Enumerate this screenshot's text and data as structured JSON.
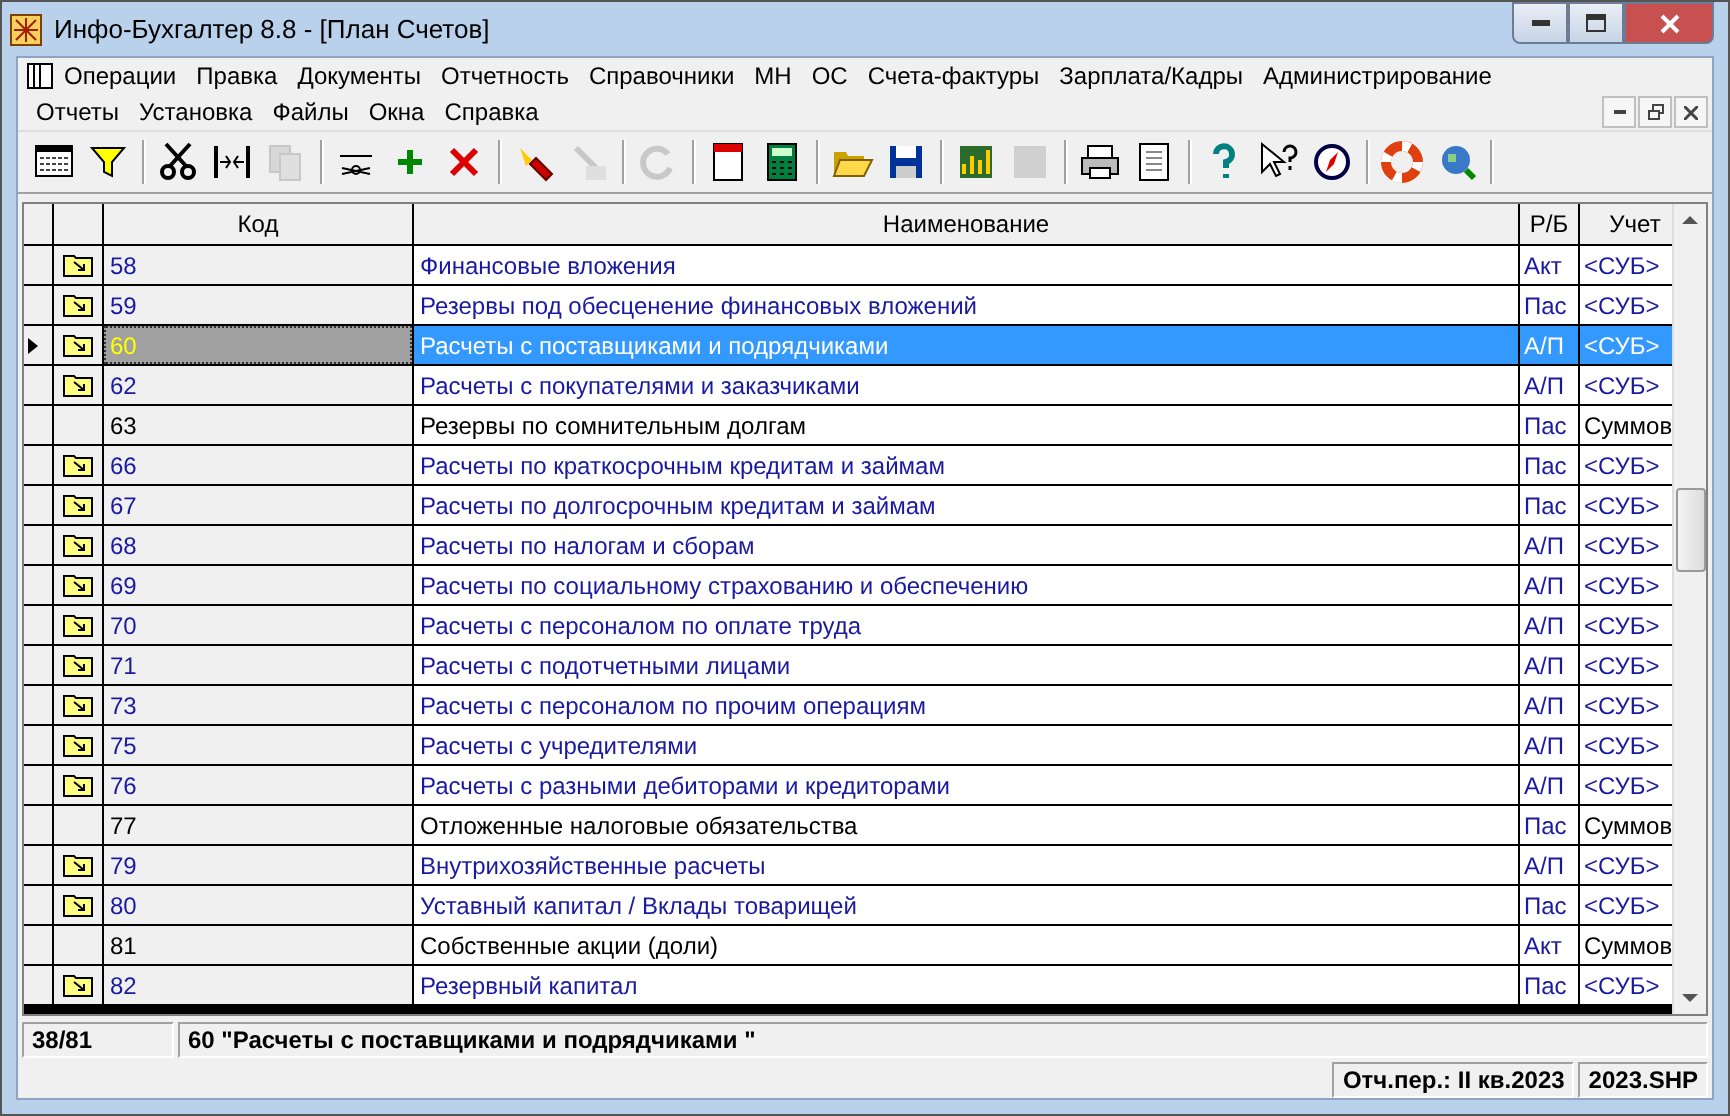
{
  "window": {
    "title": "Инфо-Бухгалтер 8.8 - [План Счетов]"
  },
  "menu": [
    [
      "Операции",
      "Правка",
      "Документы",
      "Отчетность",
      "Справочники",
      "МН",
      "ОС",
      "Счета-фактуры",
      "Зарплата/Кадры",
      "Администрирование"
    ],
    [
      "Отчеты",
      "Установка",
      "Файлы",
      "Окна",
      "Справка"
    ]
  ],
  "toolbar": [
    {
      "disabled": false
    },
    {
      "disabled": false
    },
    {
      "disabled": false
    },
    {
      "disabled": false
    },
    {
      "disabled": true
    },
    {
      "disabled": false
    },
    {
      "disabled": false
    },
    {
      "disabled": false
    },
    {
      "disabled": false
    },
    {
      "disabled": true
    },
    {
      "disabled": true
    },
    {
      "disabled": false
    },
    {
      "disabled": false
    },
    {
      "disabled": false
    },
    {
      "disabled": false
    },
    {
      "disabled": false
    },
    {
      "disabled": true
    },
    {
      "disabled": false
    },
    {
      "disabled": false
    },
    {
      "disabled": false
    },
    {
      "disabled": false
    },
    {
      "disabled": false
    },
    {
      "disabled": false
    },
    {
      "disabled": false
    }
  ],
  "table": {
    "columns": [
      "Код",
      "Наименование",
      "Р/Б",
      "Учет"
    ],
    "rows": [
      {
        "code": "58",
        "name": "Финансовые вложения",
        "rb": "Акт",
        "account": "<СУБ>",
        "folder": true,
        "selected": false
      },
      {
        "code": "59",
        "name": "Резервы под обесценение финансовых вложений",
        "rb": "Пас",
        "account": "<СУБ>",
        "folder": true,
        "selected": false
      },
      {
        "code": "60",
        "name": "Расчеты с поставщиками и подрядчиками",
        "rb": "А/П",
        "account": "<СУБ>",
        "folder": true,
        "selected": true
      },
      {
        "code": "62",
        "name": "Расчеты с покупателями и заказчиками",
        "rb": "А/П",
        "account": "<СУБ>",
        "folder": true,
        "selected": false
      },
      {
        "code": "63",
        "name": "Резервы по сомнительным долгам",
        "rb": "Пас",
        "account": "Суммов",
        "folder": false,
        "selected": false
      },
      {
        "code": "66",
        "name": "Расчеты по краткосрочным кредитам и займам",
        "rb": "Пас",
        "account": "<СУБ>",
        "folder": true,
        "selected": false
      },
      {
        "code": "67",
        "name": "Расчеты по долгосрочным кредитам и займам",
        "rb": "Пас",
        "account": "<СУБ>",
        "folder": true,
        "selected": false
      },
      {
        "code": "68",
        "name": "Расчеты по налогам и сборам",
        "rb": "А/П",
        "account": "<СУБ>",
        "folder": true,
        "selected": false
      },
      {
        "code": "69",
        "name": "Расчеты по социальному страхованию и обеспечению",
        "rb": "А/П",
        "account": "<СУБ>",
        "folder": true,
        "selected": false
      },
      {
        "code": "70",
        "name": "Расчеты с персоналом по оплате труда",
        "rb": "А/П",
        "account": "<СУБ>",
        "folder": true,
        "selected": false
      },
      {
        "code": "71",
        "name": "Расчеты с подотчетными лицами",
        "rb": "А/П",
        "account": "<СУБ>",
        "folder": true,
        "selected": false
      },
      {
        "code": "73",
        "name": "Расчеты с персоналом по прочим операциям",
        "rb": "А/П",
        "account": "<СУБ>",
        "folder": true,
        "selected": false
      },
      {
        "code": "75",
        "name": "Расчеты с учредителями",
        "rb": "А/П",
        "account": "<СУБ>",
        "folder": true,
        "selected": false
      },
      {
        "code": "76",
        "name": "Расчеты с разными дебиторами и кредиторами",
        "rb": "А/П",
        "account": "<СУБ>",
        "folder": true,
        "selected": false
      },
      {
        "code": "77",
        "name": "Отложенные налоговые обязательства",
        "rb": "Пас",
        "account": "Суммов",
        "folder": false,
        "selected": false
      },
      {
        "code": "79",
        "name": "Внутрихозяйственные расчеты",
        "rb": "А/П",
        "account": "<СУБ>",
        "folder": true,
        "selected": false
      },
      {
        "code": "80",
        "name": "Уставный капитал / Вклады товарищей",
        "rb": "Пас",
        "account": "<СУБ>",
        "folder": true,
        "selected": false
      },
      {
        "code": "81",
        "name": "Собственные акции (доли)",
        "rb": "Акт",
        "account": "Суммов",
        "folder": false,
        "selected": false
      },
      {
        "code": "82",
        "name": "Резервный капитал",
        "rb": "Пас",
        "account": "<СУБ>",
        "folder": true,
        "selected": false
      }
    ]
  },
  "status_bar": {
    "position": "38/81",
    "current": "60 \"Расчеты с поставщиками и подрядчиками \""
  },
  "footer": {
    "period": "Отч.пер.: II кв.2023",
    "file": "2023.SHP"
  }
}
